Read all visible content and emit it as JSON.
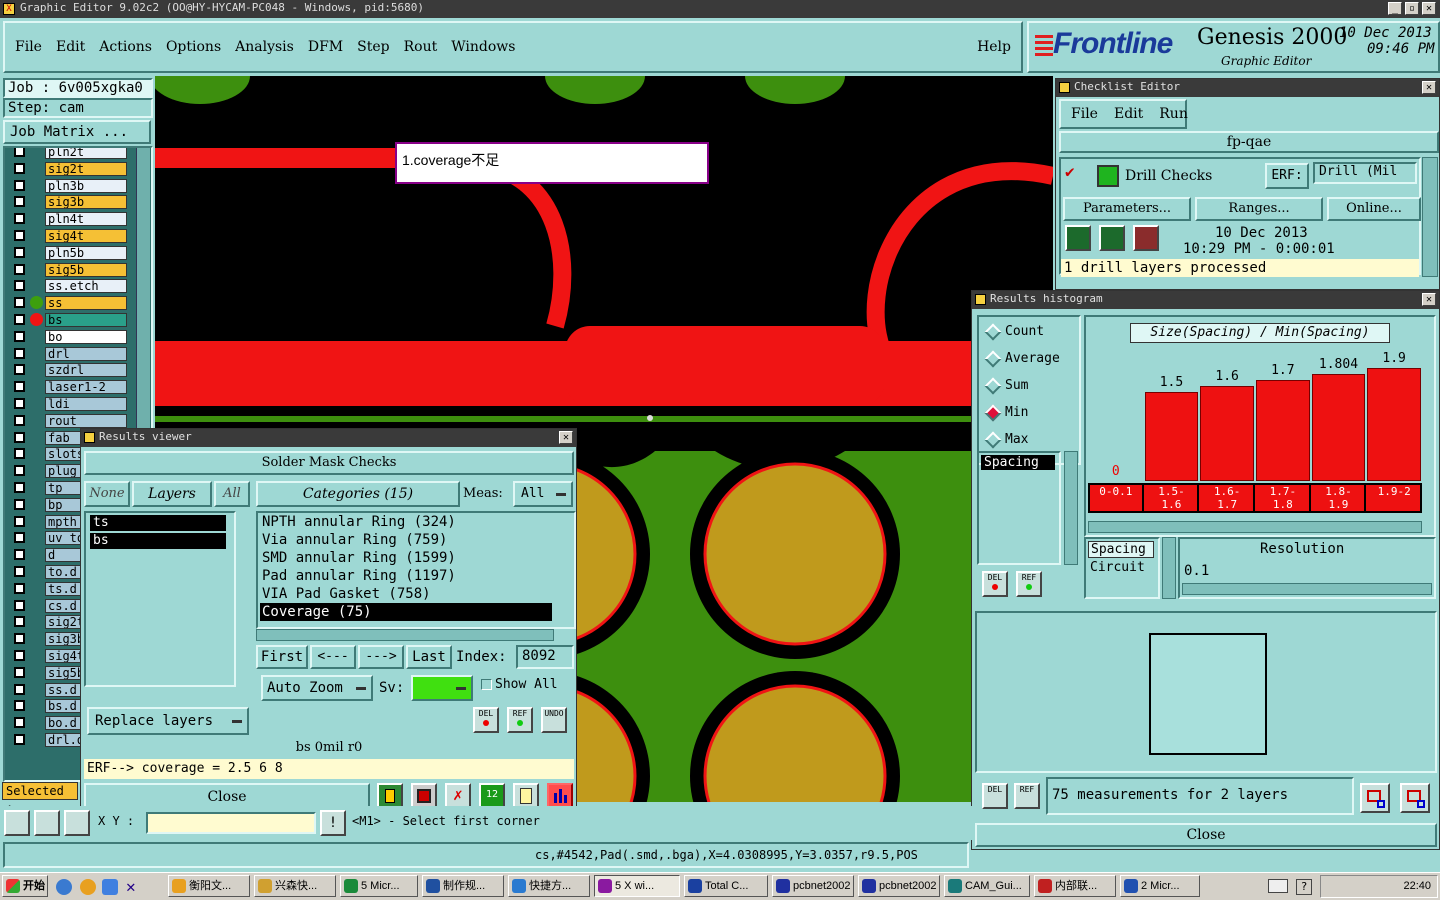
{
  "window": {
    "title": "Graphic Editor 9.02c2  (OO@HY-HYCAM-PC048 - Windows, pid:5680)"
  },
  "menu": [
    "File",
    "Edit",
    "Actions",
    "Options",
    "Analysis",
    "DFM",
    "Step",
    "Rout",
    "Windows"
  ],
  "help": "Help",
  "brand": {
    "logo": "Frontline",
    "product": "Genesis 2000",
    "subtitle": "Graphic Editor",
    "date": "10 Dec 2013",
    "time": "09:46 PM"
  },
  "job": {
    "job_label": "Job  :  6v005xgka0",
    "step_label": "Step:  cam",
    "matrix_button": "Job Matrix ..."
  },
  "layers": [
    {
      "name": "pln2t",
      "kind": "pln"
    },
    {
      "name": "sig2t",
      "kind": "sig"
    },
    {
      "name": "pln3b",
      "kind": "pln"
    },
    {
      "name": "sig3b",
      "kind": "sig"
    },
    {
      "name": "pln4t",
      "kind": "pln"
    },
    {
      "name": "sig4t",
      "kind": "sig"
    },
    {
      "name": "pln5b",
      "kind": "pln"
    },
    {
      "name": "sig5b",
      "kind": "sig"
    },
    {
      "name": "ss.etch",
      "kind": "pln"
    },
    {
      "name": "ss",
      "kind": "sig"
    },
    {
      "name": "bs",
      "kind": "act"
    },
    {
      "name": "bo",
      "kind": "wht"
    },
    {
      "name": "drl",
      "kind": "drl"
    },
    {
      "name": "szdrl",
      "kind": "drl"
    },
    {
      "name": "laser1-2",
      "kind": "drl"
    },
    {
      "name": "ldi",
      "kind": "drl"
    },
    {
      "name": "rout",
      "kind": "drl"
    },
    {
      "name": "fab",
      "kind": "drl"
    },
    {
      "name": "slots",
      "kind": "drl"
    },
    {
      "name": "plug",
      "kind": "drl"
    },
    {
      "name": "tp",
      "kind": "drl"
    },
    {
      "name": "bp",
      "kind": "drl"
    },
    {
      "name": "mpth",
      "kind": "drl"
    },
    {
      "name": "uv_to",
      "kind": "drl"
    },
    {
      "name": "d",
      "kind": "drl"
    },
    {
      "name": "to.d",
      "kind": "drl"
    },
    {
      "name": "ts.d",
      "kind": "drl"
    },
    {
      "name": "cs.d",
      "kind": "drl"
    },
    {
      "name": "sig2t",
      "kind": "drl"
    },
    {
      "name": "sig3b",
      "kind": "drl"
    },
    {
      "name": "sig4t",
      "kind": "drl"
    },
    {
      "name": "sig5b",
      "kind": "drl"
    },
    {
      "name": "ss.d",
      "kind": "drl"
    },
    {
      "name": "bs.d",
      "kind": "drl"
    },
    {
      "name": "bo.d",
      "kind": "drl"
    },
    {
      "name": "drl.d",
      "kind": "drl"
    }
  ],
  "selected_label": "Selected :",
  "canvas": {
    "annotation": "1.coverage不足"
  },
  "results_viewer": {
    "title": "Results viewer",
    "header": "Solder Mask Checks",
    "none": "None",
    "layers": "Layers",
    "all": "All",
    "categories": "Categories (15)",
    "meas_label": "Meas:",
    "meas_value": "All",
    "layer_items": [
      "ts",
      "bs"
    ],
    "category_items": [
      "NPTH annular Ring (324)",
      "Via annular Ring (759)",
      "SMD annular Ring (1599)",
      "Pad annular Ring (1197)",
      "VIA Pad Gasket (758)",
      "Coverage (75)"
    ],
    "first": "First",
    "prev": "<---",
    "next": "--->",
    "last": "Last",
    "index_label": "Index:",
    "index_value": "8092",
    "auto_zoom": "Auto Zoom",
    "sv_label": "Sv:",
    "show_all": "Show All",
    "replace_layers": "Replace layers",
    "del": "DEL",
    "ref": "REF",
    "undo": "UNDO",
    "status1": "bs 0mil  r0",
    "status2": "ERF--> coverage = 2.5 6 8",
    "close": "Close"
  },
  "checklist": {
    "title": "Checklist Editor",
    "menu": [
      "File",
      "Edit",
      "Run"
    ],
    "name": "fp-qae",
    "check_name": "Drill Checks",
    "erf_label": "ERF:",
    "erf_value": "Drill (Mil",
    "parameters": "Parameters...",
    "ranges": "Ranges...",
    "online": "Online...",
    "date": "10 Dec 2013",
    "time": "10:29 PM - 0:00:01",
    "status": "1 drill layers processed"
  },
  "histogram": {
    "title": "Results histogram",
    "options": [
      {
        "label": "Count",
        "selected": false
      },
      {
        "label": "Average",
        "selected": false
      },
      {
        "label": "Sum",
        "selected": false
      },
      {
        "label": "Min",
        "selected": true
      },
      {
        "label": "Max",
        "selected": false
      }
    ],
    "chart_title": "Size(Spacing) / Min(Spacing)",
    "selected_item": "Spacing",
    "type_list": [
      "Spacing",
      "Circuit"
    ],
    "resolution_label": "Resolution",
    "resolution_value": "0.1",
    "message": "75 measurements for 2 layers",
    "del": "DEL",
    "ref": "REF",
    "close": "Close"
  },
  "chart_data": {
    "type": "bar",
    "title": "Size(Spacing) / Min(Spacing)",
    "categories": [
      "0-0.1",
      "1.5-1.6",
      "1.6-1.7",
      "1.7-1.8",
      "1.8-1.9",
      "1.9-2"
    ],
    "values": [
      0,
      1.5,
      1.6,
      1.7,
      1.804,
      1.9
    ],
    "value_labels": [
      "0",
      "1.5",
      "1.6",
      "1.7",
      "1.804",
      "1.9"
    ],
    "ylim": [
      0,
      2.0
    ]
  },
  "coord": {
    "xy_label": "X Y :",
    "prompt": "<M1> - Select first corner"
  },
  "status_line": "cs,#4542,Pad(.smd,.bga),X=4.0308995,Y=3.0357,r9.5,POS",
  "taskbar": {
    "start": "开始",
    "items": [
      "衡阳文...",
      "兴森快...",
      "5 Micr...",
      "制作规...",
      "快捷方...",
      "5 X wi...",
      "Total C...",
      "pcbnet2002",
      "pcbnet2002",
      "CAM_Gui...",
      "内部联...",
      "2 Micr..."
    ],
    "clock": "22:40"
  },
  "colors": {
    "panel": "#9ed8d4",
    "pcb_green": "#3d8f0e",
    "trace_red": "#f01414",
    "pad_gold": "#c09a1c",
    "bar_red": "#ee1111"
  }
}
